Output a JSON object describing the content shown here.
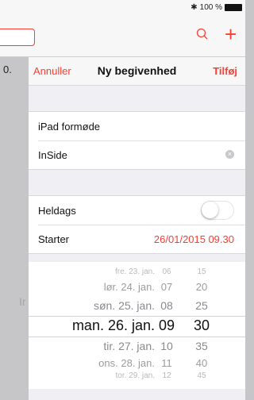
{
  "status_bar": {
    "battery_text": "100 %"
  },
  "background": {
    "day_label": "0.",
    "faded_text": "Ir"
  },
  "modal": {
    "cancel_label": "Annuller",
    "title": "Ny begivenhed",
    "add_label": "Tilføj",
    "title_field_value": "iPad formøde",
    "location_field_value": "InSide",
    "all_day_label": "Heldags",
    "all_day_on": false,
    "starts_label": "Starter",
    "starts_date": "26/01/2015",
    "starts_time": "09.30"
  },
  "picker": {
    "rows": [
      {
        "date": "fre. 23. jan.",
        "hour": "06",
        "minute": "15"
      },
      {
        "date": "lør. 24. jan.",
        "hour": "07",
        "minute": "20"
      },
      {
        "date": "søn. 25. jan.",
        "hour": "08",
        "minute": "25"
      },
      {
        "date": "man. 26. jan.",
        "hour": "09",
        "minute": "30"
      },
      {
        "date": "tir. 27. jan.",
        "hour": "10",
        "minute": "35"
      },
      {
        "date": "ons. 28. jan.",
        "hour": "11",
        "minute": "40"
      },
      {
        "date": "tor. 29. jan.",
        "hour": "12",
        "minute": "45"
      }
    ],
    "selected_index": 3
  },
  "colors": {
    "accent": "#ff3b30"
  }
}
